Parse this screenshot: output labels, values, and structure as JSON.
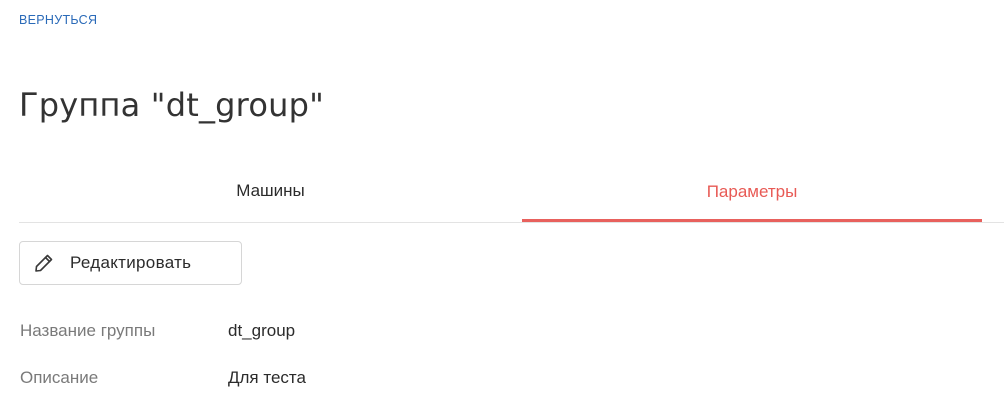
{
  "nav": {
    "back_label": "ВЕРНУТЬСЯ"
  },
  "header": {
    "title": "Группа \"dt_group\""
  },
  "tabs": [
    {
      "label": "Машины",
      "active": false
    },
    {
      "label": "Параметры",
      "active": true
    }
  ],
  "toolbar": {
    "edit_label": "Редактировать",
    "edit_icon": "pencil-icon"
  },
  "details": {
    "fields": [
      {
        "label": "Название группы",
        "value": "dt_group"
      },
      {
        "label": "Описание",
        "value": "Для теста"
      }
    ]
  },
  "colors": {
    "accent": "#e8615d",
    "link": "#2a6ab8"
  }
}
